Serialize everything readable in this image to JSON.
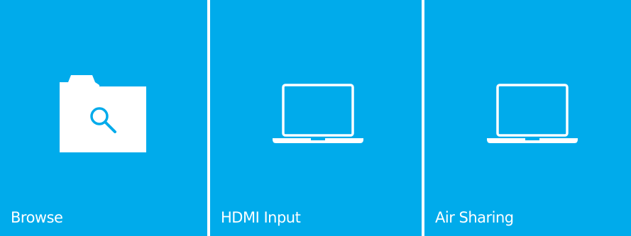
{
  "accent_color": "#00abeb",
  "tiles": [
    {
      "label": "Browse",
      "icon": "folder-search-icon"
    },
    {
      "label": "HDMI Input",
      "icon": "laptop-icon"
    },
    {
      "label": "Air Sharing",
      "icon": "laptop-icon"
    }
  ]
}
